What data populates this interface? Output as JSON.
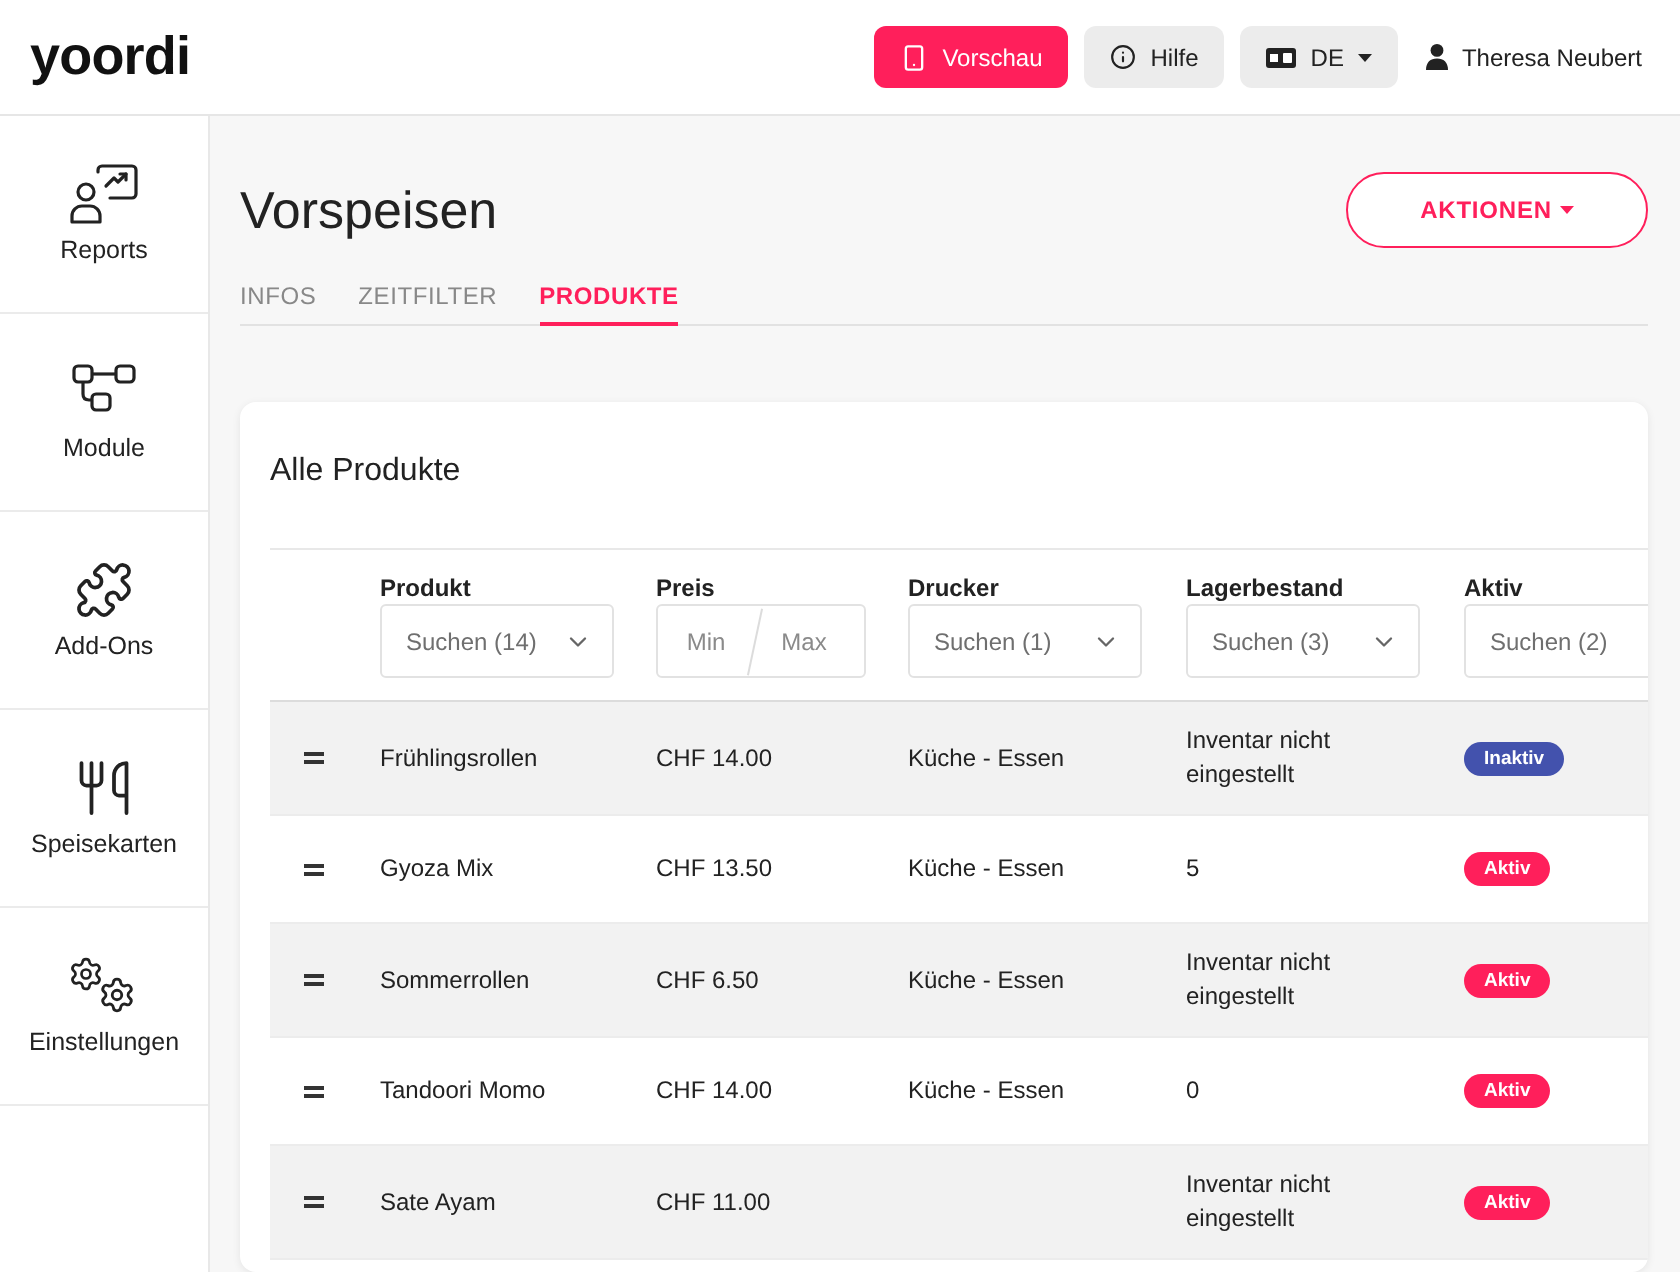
{
  "header": {
    "logo": "yoordi",
    "buttons": [
      {
        "kind": "preview",
        "label": "Vorschau"
      },
      {
        "kind": "help",
        "label": "Hilfe"
      },
      {
        "kind": "language",
        "label": "DE"
      }
    ],
    "user": {
      "name": "Theresa Neubert"
    }
  },
  "sidebar": {
    "items": [
      {
        "label": "Reports"
      },
      {
        "label": "Module"
      },
      {
        "label": "Add-Ons"
      },
      {
        "label": "Speisekarten"
      },
      {
        "label": "Einstellungen"
      }
    ]
  },
  "page": {
    "title": "Vorspeisen",
    "actions_button": "AKTIONEN",
    "tabs": [
      {
        "label": "INFOS",
        "selected": false
      },
      {
        "label": "ZEITFILTER",
        "selected": false
      },
      {
        "label": "PRODUKTE",
        "selected": true
      }
    ]
  },
  "products": {
    "title": "Alle Produkte",
    "columns": [
      {
        "label": "Produkt",
        "filter": {
          "kind": "select",
          "label": "Suchen (14)"
        }
      },
      {
        "label": "Preis",
        "filter": {
          "kind": "range",
          "min": {
            "placeholder": "Min"
          },
          "max": {
            "placeholder": "Max"
          }
        }
      },
      {
        "label": "Drucker",
        "filter": {
          "kind": "select",
          "label": "Suchen (1)"
        }
      },
      {
        "label": "Lagerbestand",
        "filter": {
          "kind": "select",
          "label": "Suchen (3)"
        }
      },
      {
        "label": "Aktiv",
        "filter": {
          "kind": "select",
          "label": "Suchen (2)"
        }
      }
    ],
    "rows": [
      {
        "product": "Frühlingsrollen",
        "price": "CHF 14.00",
        "printer": "Küche - Essen",
        "stock": "Inventar nicht eingestellt",
        "status": {
          "label": "Inaktiv",
          "active": false
        }
      },
      {
        "product": "Gyoza Mix",
        "price": "CHF 13.50",
        "printer": "Küche - Essen",
        "stock": "5",
        "status": {
          "label": "Aktiv",
          "active": true
        }
      },
      {
        "product": "Sommerrollen",
        "price": "CHF 6.50",
        "printer": "Küche - Essen",
        "stock": "Inventar nicht eingestellt",
        "status": {
          "label": "Aktiv",
          "active": true
        }
      },
      {
        "product": "Tandoori Momo",
        "price": "CHF 14.00",
        "printer": "Küche - Essen",
        "stock": "0",
        "status": {
          "label": "Aktiv",
          "active": true
        }
      },
      {
        "product": "Sate Ayam",
        "price": "CHF 11.00",
        "stock": "Inventar nicht eingestellt",
        "status": {
          "label": "Aktiv",
          "active": true
        }
      }
    ]
  }
}
